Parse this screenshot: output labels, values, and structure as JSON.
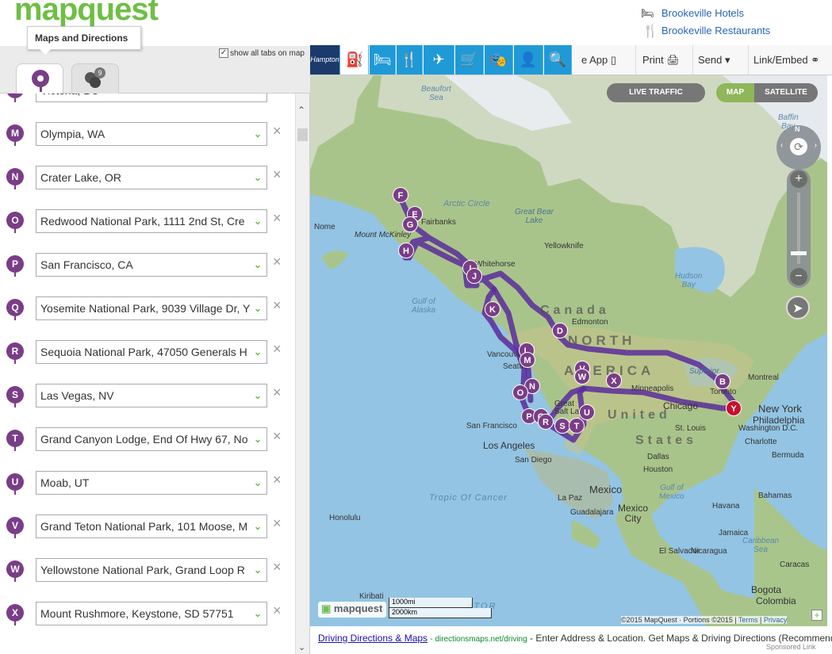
{
  "header": {
    "logo": "mapquest",
    "hotels_link": "Brookeville Hotels",
    "restaurants_link": "Brookeville Restaurants",
    "tooltip": "Maps and Directions"
  },
  "leftpane": {
    "show_all_label": "show all tabs on map",
    "tab2_badge": "9"
  },
  "stops": [
    {
      "letter": "L",
      "value": "Victoria, BC"
    },
    {
      "letter": "M",
      "value": "Olympia, WA"
    },
    {
      "letter": "N",
      "value": "Crater Lake, OR"
    },
    {
      "letter": "O",
      "value": "Redwood National Park, 1111 2nd St, Cre"
    },
    {
      "letter": "P",
      "value": "San Francisco, CA"
    },
    {
      "letter": "Q",
      "value": "Yosemite National Park, 9039 Village Dr, Y"
    },
    {
      "letter": "R",
      "value": "Sequoia National Park, 47050 Generals H"
    },
    {
      "letter": "S",
      "value": "Las Vegas, NV"
    },
    {
      "letter": "T",
      "value": "Grand Canyon Lodge, End Of Hwy 67, No"
    },
    {
      "letter": "U",
      "value": "Moab, UT"
    },
    {
      "letter": "V",
      "value": "Grand Teton National Park, 101 Moose, M"
    },
    {
      "letter": "W",
      "value": "Yellowstone National Park, Grand Loop R"
    },
    {
      "letter": "X",
      "value": "Mount Rushmore, Keystone, SD 57751"
    }
  ],
  "toolbar": {
    "brand": "Hampton",
    "app_label": "e App",
    "print_label": "Print",
    "send_label": "Send",
    "link_label": "Link/Embed"
  },
  "map": {
    "live_traffic": "LIVE TRAFFIC",
    "map_btn": "MAP",
    "satellite_btn": "SATELLITE",
    "compass_n": "N",
    "scale_mi": "1000mi",
    "scale_km": "2000km",
    "mq_logo": "mapquest",
    "copyright": "©2015 MapQuest · Portions ©2015",
    "terms": "Terms",
    "privacy": "Privacy",
    "labels": {
      "beaufort": "Beaufort\nSea",
      "baffin": "Baffin\nBay",
      "hudson": "Hudson\nBay",
      "alaska_gulf": "Gulf of\nAlaska",
      "mexico_gulf": "Gulf of\nMexico",
      "caribbean": "Caribbean\nSea",
      "arctic": "Arctic Circle",
      "tropic": "Tropic Of Cancer",
      "greatbear": "Great Bear\nLake",
      "fairbanks": "Fairbanks",
      "nome": "Nome",
      "mckinley": "Mount McKinley",
      "yellowknife": "Yellowknife",
      "whitehorse": "Whitehorse",
      "edmonton": "Edmonton",
      "vancouver": "Vancouver",
      "seattle": "Seattle",
      "sanfrancisco": "San Francisco",
      "losangeles": "Los Angeles",
      "sandiego": "San Diego",
      "saltlake": "Great\nSalt Lake",
      "minneapolis": "Minneapolis",
      "chicago": "Chicago",
      "stlouis": "St. Louis",
      "dallas": "Dallas",
      "houston": "Houston",
      "charlotte": "Charlotte",
      "montreal": "Montreal",
      "toronto": "Toronto",
      "newyork": "New York",
      "philadelphia": "Philadelphia",
      "washington": "Washington D.C.",
      "bermuda": "Bermuda",
      "bahamas": "Bahamas",
      "superior": "Superior",
      "mexico": "Mexico",
      "mexicocity": "Mexico\nCity",
      "lapaz": "La Paz",
      "guadalajara": "Guadalajara",
      "honolulu": "Honolulu",
      "kiribati": "Kiribati",
      "havana": "Havana",
      "jamaica": "Jamaica",
      "elsalvador": "El Salvador",
      "nicaragua": "Nicaragua",
      "bogota": "Bogota",
      "colombia": "Colombia",
      "caracas": "Caracas",
      "equator": "ATOR",
      "canada": "Canada",
      "north": "NORTH",
      "america": "AMERICA",
      "united": "United",
      "states": "States"
    },
    "pins": [
      "F",
      "E",
      "G",
      "H",
      "I",
      "J",
      "K",
      "D",
      "L",
      "M",
      "N",
      "O",
      "P",
      "Q",
      "R",
      "S",
      "T",
      "U",
      "V",
      "W",
      "X",
      "B",
      "Y"
    ]
  },
  "footer": {
    "ad_link": "Driving Directions & Maps",
    "ad_url": "directionsmaps.net/driving",
    "ad_text": "Enter Address & Location. Get Maps & Driving Directions (Recommende",
    "sponsored": "Sponsored Link"
  },
  "colors": {
    "brand_green": "#6fbe44",
    "toolbar_blue": "#1f9ad6",
    "pin_purple": "#7a3d87",
    "route_purple": "#5a2d9a",
    "destination_red": "#c8102e"
  }
}
